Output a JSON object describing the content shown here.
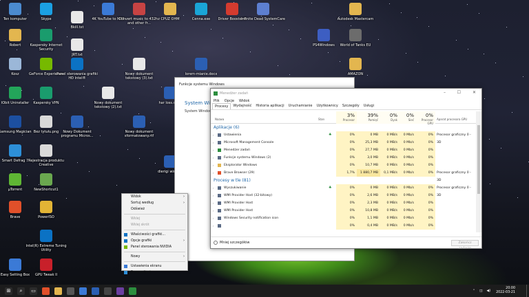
{
  "desktop_icons": [
    {
      "label": "Ten komputer",
      "icon": "computer-icon",
      "color": "#4b8bd0"
    },
    {
      "label": "Skype",
      "icon": "skype-icon",
      "color": "#1ba0e3"
    },
    {
      "label": "Bkill.txt",
      "icon": "text-file-icon",
      "color": "#e8e8e8"
    },
    {
      "label": "4K YouTube to MP3",
      "icon": "music-app-icon",
      "color": "#3b7ad6"
    },
    {
      "label": "Convert music to 432hz and other fr...",
      "icon": "convert-icon",
      "color": "#c74343"
    },
    {
      "label": "CPUZ OHM",
      "icon": "folder-icon",
      "color": "#e3b64f"
    },
    {
      "label": "Cenna.exe",
      "icon": "exe-icon",
      "color": "#1aa5d6"
    },
    {
      "label": "Driver Booster 6",
      "icon": "driver-booster-icon",
      "color": "#d43b2f"
    },
    {
      "label": "Infinite Dead SystemCare",
      "icon": "systemcare-icon",
      "color": "#5d7fd1"
    },
    {
      "label": "Autodesk Mastercam",
      "icon": "autodesk-icon",
      "color": "#e3b64f"
    },
    {
      "label": "Robert",
      "icon": "user-folder-icon",
      "color": "#e3b64f"
    },
    {
      "label": "Kaspersky Internet Security",
      "icon": "kaspersky-icon",
      "color": "#1a9c6d"
    },
    {
      "label": "JRT.txt",
      "icon": "text-file-icon",
      "color": "#e8e8e8"
    },
    {
      "label": "PS4Windows",
      "icon": "gamepad-icon",
      "color": "#3d5ec2"
    },
    {
      "label": "World of Tanks EU",
      "icon": "tank-icon",
      "color": "#6c6c6c"
    },
    {
      "label": "Kosz",
      "icon": "recycle-bin-icon",
      "color": "#9bb7d8"
    },
    {
      "label": "GeForce Experience",
      "icon": "nvidia-icon",
      "color": "#76b900"
    },
    {
      "label": "Panel sterowania grafiki HD Intel®",
      "icon": "intel-graphics-icon",
      "color": "#0b72c4"
    },
    {
      "label": "Nowy dokument tekstowy (3).txt",
      "icon": "text-file-icon",
      "color": "#e8e8e8"
    },
    {
      "label": "lorem-mianie.docx",
      "icon": "word-icon",
      "color": "#2b5fb3"
    },
    {
      "label": "AMAZON",
      "icon": "folder-icon",
      "color": "#e3b64f"
    },
    {
      "label": "IObit Uninstaller",
      "icon": "uninstaller-icon",
      "color": "#23a55a"
    },
    {
      "label": "Kaspersky VPN",
      "icon": "vpn-icon",
      "color": "#1a9c6d"
    },
    {
      "label": "Nowy dokument tekstowy (2).txt",
      "icon": "text-file-icon",
      "color": "#e8e8e8"
    },
    {
      "label": "har loss.docx",
      "icon": "word-icon",
      "color": "#2b5fb3"
    },
    {
      "label": "Samsung Magician",
      "icon": "samsung-icon",
      "color": "#1c4fa0"
    },
    {
      "label": "Bez tytułu.png",
      "icon": "image-file-icon",
      "color": "#d9d9d9"
    },
    {
      "label": "Nowy Dokument programu Micros...",
      "icon": "word-icon",
      "color": "#2b5fb3"
    },
    {
      "label": "Nowy dokument sformatowany.rtf",
      "icon": "word-icon",
      "color": "#2b5fb3"
    },
    {
      "label": "Smart Defrag 7",
      "icon": "defrag-icon",
      "color": "#2d8fd8"
    },
    {
      "label": "Rejestracja produktu Creative",
      "icon": "creative-icon",
      "color": "#d9d9d9"
    },
    {
      "label": "dierigi wintu...",
      "icon": "word-icon",
      "color": "#2b5fb3"
    },
    {
      "label": "µTorrent",
      "icon": "utorrent-icon",
      "color": "#5fb634"
    },
    {
      "label": "NewShortcut1",
      "icon": "shortcut-icon",
      "color": "#6aa84f"
    },
    {
      "label": "Brave",
      "icon": "brave-icon",
      "color": "#e1502a"
    },
    {
      "label": "PowerISO",
      "icon": "poweriso-icon",
      "color": "#e2b435"
    },
    {
      "label": "Intel(R) Extreme Tuning Utility",
      "icon": "intel-xtu-icon",
      "color": "#0b72c4"
    },
    {
      "label": "Easy Setting Box",
      "icon": "setting-box-icon",
      "color": "#3b7ad6"
    },
    {
      "label": "GPU Tweak II",
      "icon": "gpu-tweak-icon",
      "color": "#c8202a"
    }
  ],
  "bg_window": {
    "title": "Funkcje systemu Windows",
    "heading": "System Wind...",
    "subtext": "System Windows"
  },
  "task_manager": {
    "title": "Menedżer zadań",
    "menu": [
      "Plik",
      "Opcje",
      "Widok"
    ],
    "tabs": [
      "Procesy",
      "Wydajność",
      "Historia aplikacji",
      "Uruchamianie",
      "Użytkownicy",
      "Szczegóły",
      "Usługi"
    ],
    "columns": [
      {
        "name": "Nazwa",
        "pct": ""
      },
      {
        "name": "Stan",
        "pct": ""
      },
      {
        "name": "Procesor",
        "pct": "3%"
      },
      {
        "name": "Pamięć",
        "pct": "39%"
      },
      {
        "name": "Dysk",
        "pct": "0%"
      },
      {
        "name": "Sieć",
        "pct": "0%"
      },
      {
        "name": "Procesor GPU",
        "pct": "0%"
      },
      {
        "name": "Aparat procesora GPU",
        "pct": ""
      }
    ],
    "sections": [
      {
        "title": "Aplikacje (6)",
        "rows": [
          {
            "name": "Ustawienia",
            "icon": "settings-icon",
            "leaf": true,
            "cpu": "0%",
            "mem": "0 MB",
            "disk": "0 MB/s",
            "net": "0 Mb/s",
            "gpu": "0%",
            "engine": "Procesor graficzny 0 - 3D"
          },
          {
            "name": "Microsoft Management Console",
            "icon": "mmc-icon",
            "leaf": false,
            "cpu": "0%",
            "mem": "25,3 MB",
            "disk": "0 MB/s",
            "net": "0 Mb/s",
            "gpu": "0%",
            "engine": ""
          },
          {
            "name": "Menedżer zadań",
            "icon": "task-manager-icon",
            "leaf": false,
            "cpu": "0%",
            "mem": "27,7 MB",
            "disk": "0 MB/s",
            "net": "0 Mb/s",
            "gpu": "0%",
            "engine": ""
          },
          {
            "name": "Funkcje systemu Windows (2)",
            "icon": "windows-features-icon",
            "leaf": false,
            "cpu": "0%",
            "mem": "3,0 MB",
            "disk": "0 MB/s",
            "net": "0 Mb/s",
            "gpu": "0%",
            "engine": ""
          },
          {
            "name": "Eksplorator Windows",
            "icon": "explorer-icon",
            "leaf": false,
            "cpu": "0%",
            "mem": "10,7 MB",
            "disk": "0 MB/s",
            "net": "0 Mb/s",
            "gpu": "0%",
            "engine": ""
          },
          {
            "name": "Brave Browser (29)",
            "icon": "brave-icon",
            "leaf": false,
            "cpu": "1,7%",
            "mem": "1 880,7 MB",
            "disk": "0,1 MB/s",
            "net": "0 Mb/s",
            "gpu": "0%",
            "engine": "Procesor graficzny 0 - 3D"
          }
        ]
      },
      {
        "title": "Procesy w tle (81)",
        "rows": [
          {
            "name": "Wyszukiwanie",
            "icon": "search-icon",
            "leaf": true,
            "cpu": "0%",
            "mem": "0 MB",
            "disk": "0 MB/s",
            "net": "0 Mb/s",
            "gpu": "0%",
            "engine": "Procesor graficzny 0 - 3D"
          },
          {
            "name": "WMI Provider Host (32-bitowy)",
            "icon": "wmi-icon",
            "leaf": false,
            "cpu": "0%",
            "mem": "2,6 MB",
            "disk": "0 MB/s",
            "net": "0 Mb/s",
            "gpu": "0%",
            "engine": ""
          },
          {
            "name": "WMI Provider Host",
            "icon": "wmi-icon",
            "leaf": false,
            "cpu": "0%",
            "mem": "2,3 MB",
            "disk": "0 MB/s",
            "net": "0 Mb/s",
            "gpu": "0%",
            "engine": ""
          },
          {
            "name": "WMI Provider Host",
            "icon": "wmi-icon",
            "leaf": false,
            "cpu": "0%",
            "mem": "10,8 MB",
            "disk": "0 MB/s",
            "net": "0 Mb/s",
            "gpu": "0%",
            "engine": ""
          },
          {
            "name": "Windows Security notification icon",
            "icon": "security-icon",
            "leaf": false,
            "cpu": "0%",
            "mem": "1,1 MB",
            "disk": "0 MB/s",
            "net": "0 Mb/s",
            "gpu": "0%",
            "engine": ""
          },
          {
            "name": "",
            "icon": "process-icon",
            "leaf": false,
            "cpu": "0%",
            "mem": "0,4 MB",
            "disk": "0 MB/s",
            "net": "0 Mb/s",
            "gpu": "0%",
            "engine": ""
          }
        ]
      }
    ],
    "less_details": "Mniej szczegółów",
    "end_task": "Zakończ zadanie"
  },
  "context_menu": {
    "items": [
      {
        "label": "Widok",
        "sub": true,
        "dis": false,
        "icon": ""
      },
      {
        "label": "Sortuj według",
        "sub": true,
        "dis": false,
        "icon": ""
      },
      {
        "label": "Odśwież",
        "sub": false,
        "dis": false,
        "icon": ""
      },
      {
        "sep": true
      },
      {
        "label": "Wklej",
        "sub": false,
        "dis": true,
        "icon": ""
      },
      {
        "label": "Wklej skrót",
        "sub": false,
        "dis": true,
        "icon": ""
      },
      {
        "sep": true
      },
      {
        "label": "Właściwości grafiki...",
        "sub": false,
        "dis": false,
        "icon": "intel-graphics-icon"
      },
      {
        "label": "Opcje grafiki",
        "sub": true,
        "dis": false,
        "icon": "intel-graphics-icon"
      },
      {
        "label": "Panel sterowania NVIDIA",
        "sub": false,
        "dis": false,
        "icon": "nvidia-icon"
      },
      {
        "sep": true
      },
      {
        "label": "Nowy",
        "sub": true,
        "dis": false,
        "icon": ""
      },
      {
        "sep": true
      },
      {
        "label": "Ustawienia ekranu",
        "sub": false,
        "dis": false,
        "icon": "display-icon"
      },
      {
        "label": "Personalizuj",
        "sub": false,
        "dis": false,
        "icon": "personalize-icon"
      }
    ]
  },
  "taskbar": {
    "icons": [
      {
        "name": "start-icon",
        "color": "#2b2b2b"
      },
      {
        "name": "search-icon",
        "color": "#2b2b2b"
      },
      {
        "name": "task-view-icon",
        "color": "#2b2b2b"
      },
      {
        "name": "brave-icon",
        "color": "#e1502a"
      },
      {
        "name": "file-explorer-icon",
        "color": "#e3b64f"
      },
      {
        "name": "settings-icon",
        "color": "#555555"
      },
      {
        "name": "photos-icon",
        "color": "#3b7ad6"
      },
      {
        "name": "word-icon",
        "color": "#2b5fb3"
      },
      {
        "name": "calculator-icon",
        "color": "#444444"
      },
      {
        "name": "app-icon",
        "color": "#6b3fa0"
      },
      {
        "name": "task-manager-icon",
        "color": "#2c8e3e"
      }
    ],
    "time": "20:00",
    "date": "2022-03-21"
  },
  "colors": {
    "accent": "#1e66a8",
    "heat_light": "#fff4c4",
    "heat_mid": "#f9e79f"
  }
}
